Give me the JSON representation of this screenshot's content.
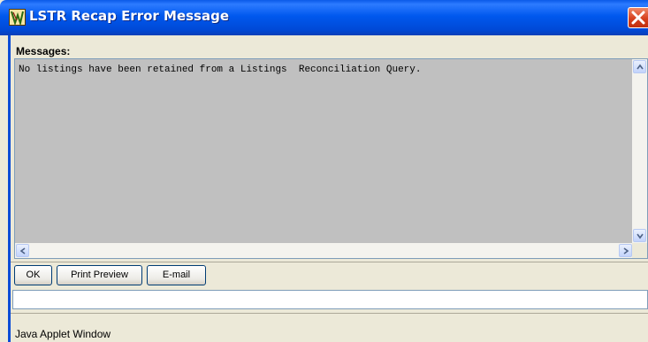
{
  "window": {
    "title": "LSTR Recap Error Message"
  },
  "messages": {
    "label": "Messages:",
    "text": "No listings have been retained from a Listings  Reconciliation Query."
  },
  "buttons": {
    "ok": "OK",
    "print_preview": "Print Preview",
    "email": "E-mail"
  },
  "status": {
    "text": "Java Applet Window"
  },
  "icons": {
    "app": "app-logo-icon",
    "close": "close-icon",
    "scroll_up": "scroll-up-arrow-icon",
    "scroll_down": "scroll-down-arrow-icon",
    "scroll_left": "scroll-left-arrow-icon",
    "scroll_right": "scroll-right-arrow-icon"
  },
  "colors": {
    "titlebar": "#0058ee",
    "close": "#d6401e",
    "textarea_bg": "#c0c0c0",
    "dialog_bg": "#ece9d8"
  }
}
